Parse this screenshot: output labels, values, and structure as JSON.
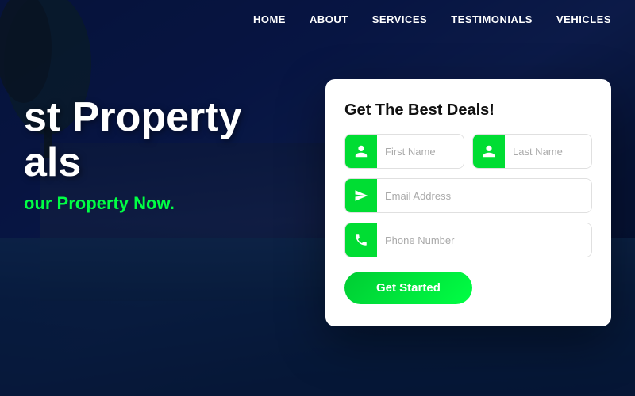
{
  "navbar": {
    "links": [
      {
        "label": "HOME",
        "id": "home"
      },
      {
        "label": "ABOUT",
        "id": "about"
      },
      {
        "label": "SERVICES",
        "id": "services"
      },
      {
        "label": "TESTIMONIALS",
        "id": "testimonials"
      },
      {
        "label": "VEHICLES",
        "id": "vehicles"
      }
    ]
  },
  "hero": {
    "line1": "st Property",
    "line2": "als",
    "cta": "our Property Now."
  },
  "form": {
    "title": "Get The Best Deals!",
    "first_name_placeholder": "First Name",
    "last_name_placeholder": "Last Name",
    "email_placeholder": "Email Address",
    "phone_placeholder": "Phone Number",
    "submit_label": "Get Started"
  },
  "colors": {
    "green": "#00dd33",
    "dark_blue": "#0a1a4a",
    "accent_green": "#00ff44"
  }
}
